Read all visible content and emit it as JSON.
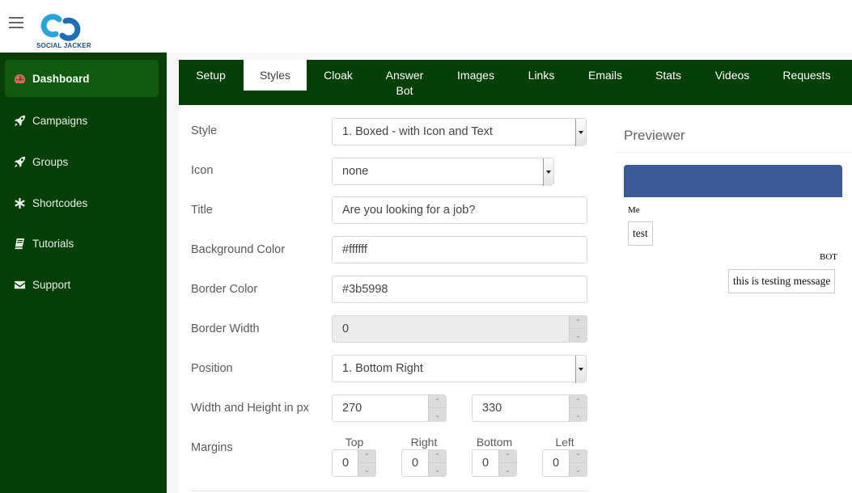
{
  "brand": {
    "name": "SOCIAL JACKER"
  },
  "sidebar": {
    "items": [
      {
        "label": "Dashboard",
        "icon": "dashboard-icon"
      },
      {
        "label": "Campaigns",
        "icon": "rocket-icon"
      },
      {
        "label": "Groups",
        "icon": "rocket-icon"
      },
      {
        "label": "Shortcodes",
        "icon": "asterisk-icon"
      },
      {
        "label": "Tutorials",
        "icon": "book-icon"
      },
      {
        "label": "Support",
        "icon": "envelope-icon"
      }
    ]
  },
  "tabs": [
    {
      "label": "Setup"
    },
    {
      "label": "Styles"
    },
    {
      "label": "Cloak"
    },
    {
      "label": "Answer Bot"
    },
    {
      "label": "Images"
    },
    {
      "label": "Links"
    },
    {
      "label": "Emails"
    },
    {
      "label": "Stats"
    },
    {
      "label": "Videos"
    },
    {
      "label": "Requests"
    }
  ],
  "form": {
    "style": {
      "label": "Style",
      "value": "1. Boxed - with Icon and Text"
    },
    "icon": {
      "label": "Icon",
      "value": "none"
    },
    "title": {
      "label": "Title",
      "value": "Are you looking for a job?"
    },
    "background_color": {
      "label": "Background Color",
      "value": "#ffffff"
    },
    "border_color": {
      "label": "Border Color",
      "value": "#3b5998"
    },
    "border_width": {
      "label": "Border Width",
      "value": "0"
    },
    "position": {
      "label": "Position",
      "value": "1. Bottom Right"
    },
    "size": {
      "label": "Width and Height in px",
      "width": "270",
      "height": "330"
    },
    "margins": {
      "label": "Margins",
      "top_label": "Top",
      "top": "0",
      "right_label": "Right",
      "right": "0",
      "bottom_label": "Bottom",
      "bottom": "0",
      "left_label": "Left",
      "left": "0"
    }
  },
  "previewer": {
    "title": "Previewer",
    "header_color": "#3b5998",
    "me_label": "Me",
    "me_message": "test",
    "bot_label": "BOT",
    "bot_message": "this is testing message"
  },
  "colors": {
    "sidebar": "#053f05",
    "active_item": "#0f5a0f",
    "accent": "#e8665a"
  }
}
